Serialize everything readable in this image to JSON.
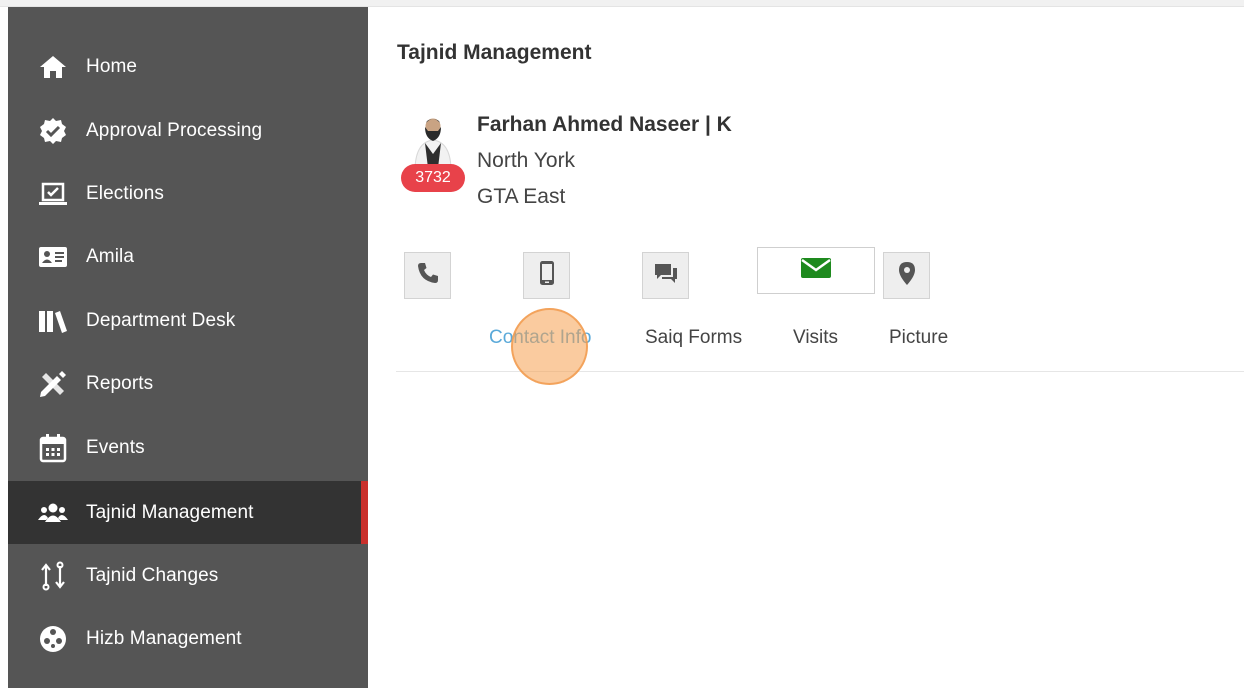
{
  "sidebar": {
    "items": [
      {
        "label": "Home",
        "icon": "home-icon"
      },
      {
        "label": "Approval Processing",
        "icon": "check-badge-icon"
      },
      {
        "label": "Elections",
        "icon": "laptop-check-icon"
      },
      {
        "label": "Amila",
        "icon": "id-card-icon"
      },
      {
        "label": "Department Desk",
        "icon": "books-icon"
      },
      {
        "label": "Reports",
        "icon": "pencil-ruler-icon"
      },
      {
        "label": "Events",
        "icon": "calendar-icon"
      },
      {
        "label": "Tajnid Management",
        "icon": "users-icon",
        "active": true
      },
      {
        "label": "Tajnid Changes",
        "icon": "exchange-icon"
      },
      {
        "label": "Hizb Management",
        "icon": "film-reel-icon"
      }
    ]
  },
  "main": {
    "title": "Tajnid Management",
    "person": {
      "name": "Farhan Ahmed Naseer | K",
      "city": "North York",
      "region": "GTA East",
      "badge": "3732"
    },
    "actions": [
      "phone-icon",
      "mobile-icon",
      "chat-icon",
      "email-icon",
      "location-icon"
    ],
    "tabs": [
      {
        "label": "Contact Info",
        "active": true
      },
      {
        "label": "Saiq Forms"
      },
      {
        "label": "Visits"
      },
      {
        "label": "Picture"
      }
    ]
  },
  "colors": {
    "sidebar_bg": "#555555",
    "sidebar_active_bg": "#333333",
    "active_indicator": "#c9302c",
    "badge": "#e8424a",
    "email_icon": "#1e8a1e",
    "active_tab": "#5aa9d9"
  }
}
